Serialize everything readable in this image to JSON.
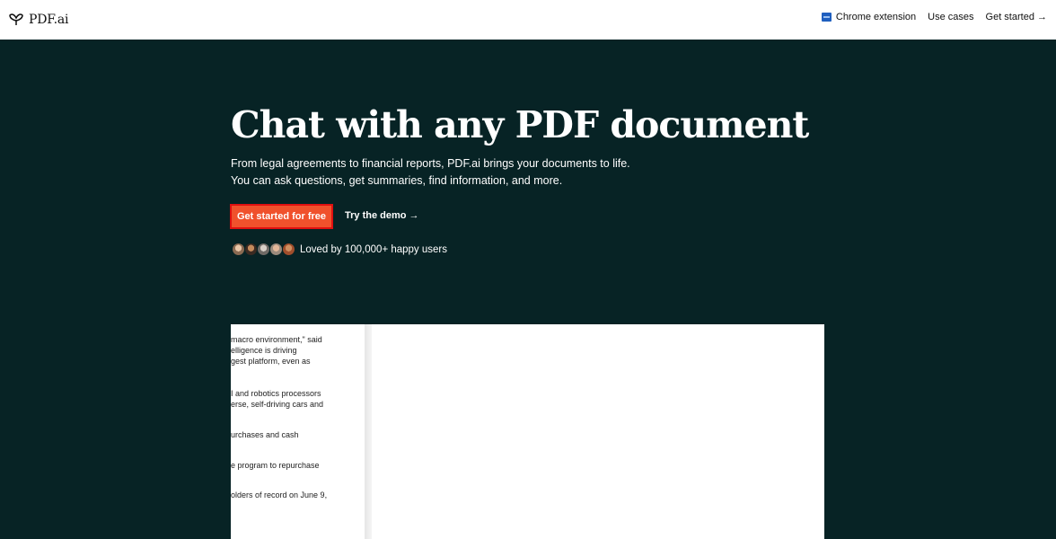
{
  "brand": {
    "name": "PDF.ai"
  },
  "nav": {
    "items": [
      {
        "label": "Chrome extension",
        "icon": "chrome-extension-icon"
      },
      {
        "label": "Use cases"
      },
      {
        "label": "Get started →"
      }
    ]
  },
  "hero": {
    "title": "Chat with any PDF document",
    "subtitle_lines": [
      "From legal agreements to financial reports, PDF.ai brings your documents to life.",
      "You can ask questions, get summaries, find information, and more."
    ],
    "cta_label": "Get started for free",
    "demo_label": "Try the demo →",
    "social_proof": "Loved by 100,000+ happy users"
  },
  "preview": {
    "doc_lines": [
      "macro environment,\" said",
      "elligence is driving",
      "gest platform, even as",
      "I and robotics processors",
      "erse, self-driving cars and",
      "urchases and cash",
      "e program to repurchase",
      "olders of record on June 9,"
    ]
  },
  "colors": {
    "background": "#072325",
    "cta": "#f0512c",
    "cta_border": "#e01010",
    "white": "#ffffff"
  }
}
